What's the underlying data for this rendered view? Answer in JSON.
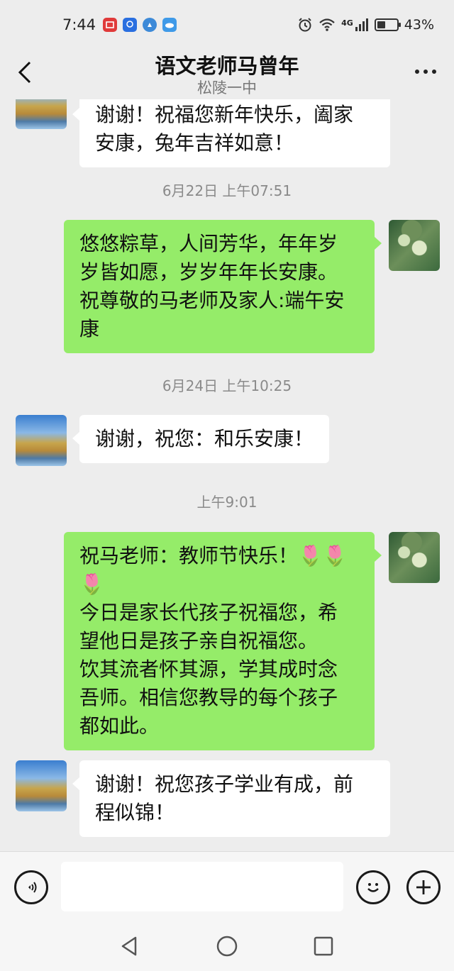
{
  "status_bar": {
    "time": "7:44",
    "network": "4G",
    "battery_percent": "43%",
    "battery_level": 0.43
  },
  "header": {
    "title": "语文老师马曾年",
    "subtitle": "松陵一中"
  },
  "messages": [
    {
      "side": "in",
      "text": "谢谢！祝福您新年快乐，阖家\n安康，兔年吉祥如意！"
    },
    {
      "time": "6月22日 上午07:51"
    },
    {
      "side": "out",
      "text": "悠悠粽草，人间芳华，年年岁\n岁皆如愿，岁岁年年长安康。\n祝尊敬的马老师及家人:端午安\n康"
    },
    {
      "time": "6月24日 上午10:25"
    },
    {
      "side": "in",
      "text": "谢谢，祝您：和乐安康！"
    },
    {
      "time": "上午9:01"
    },
    {
      "side": "out",
      "text": "祝马老师：教师节快乐！🌷🌷\n🌷\n今日是家长代孩子祝福您，希\n望他日是孩子亲自祝福您。\n饮其流者怀其源，学其成时念\n吾师。相信您教导的每个孩子\n都如此。"
    },
    {
      "side": "in",
      "text": "谢谢！祝您孩子学业有成，前\n程似锦！"
    }
  ],
  "input": {
    "value": ""
  },
  "icons": {
    "back": "back-arrow-icon",
    "more": "more-dots-icon",
    "voice": "voice-icon",
    "emoji": "emoji-icon",
    "plus": "plus-icon"
  },
  "colors": {
    "outgoing_bubble": "#95ec69",
    "incoming_bubble": "#ffffff",
    "background": "#ededed"
  }
}
